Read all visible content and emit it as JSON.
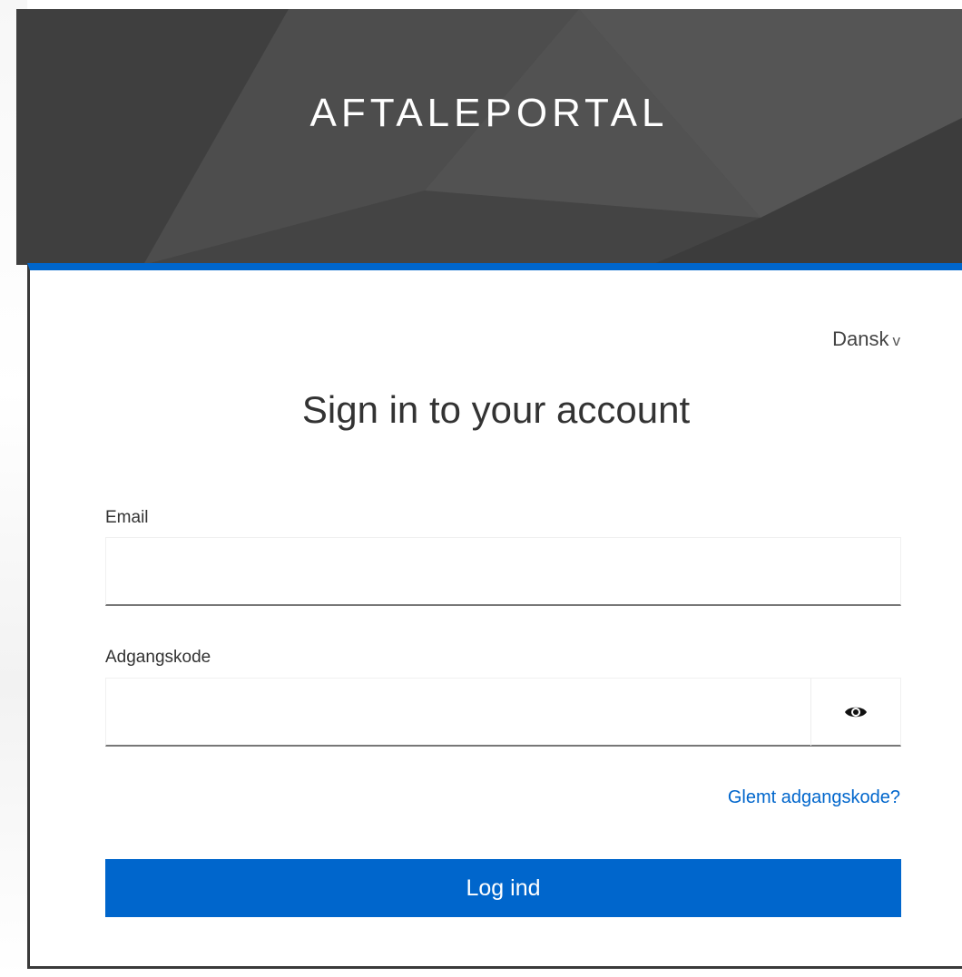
{
  "header": {
    "title": "AFTALEPORTAL"
  },
  "language": {
    "selected": "Dansk",
    "chevron": "v"
  },
  "login": {
    "title": "Sign in to your account",
    "email_label": "Email",
    "email_value": "",
    "password_label": "Adgangskode",
    "password_value": "",
    "show_password_icon": "eye-icon",
    "forgot_link": "Glemt adgangskode?",
    "submit_label": "Log ind"
  },
  "colors": {
    "accent": "#0066cc",
    "header_bg": "#4a4a4a"
  }
}
